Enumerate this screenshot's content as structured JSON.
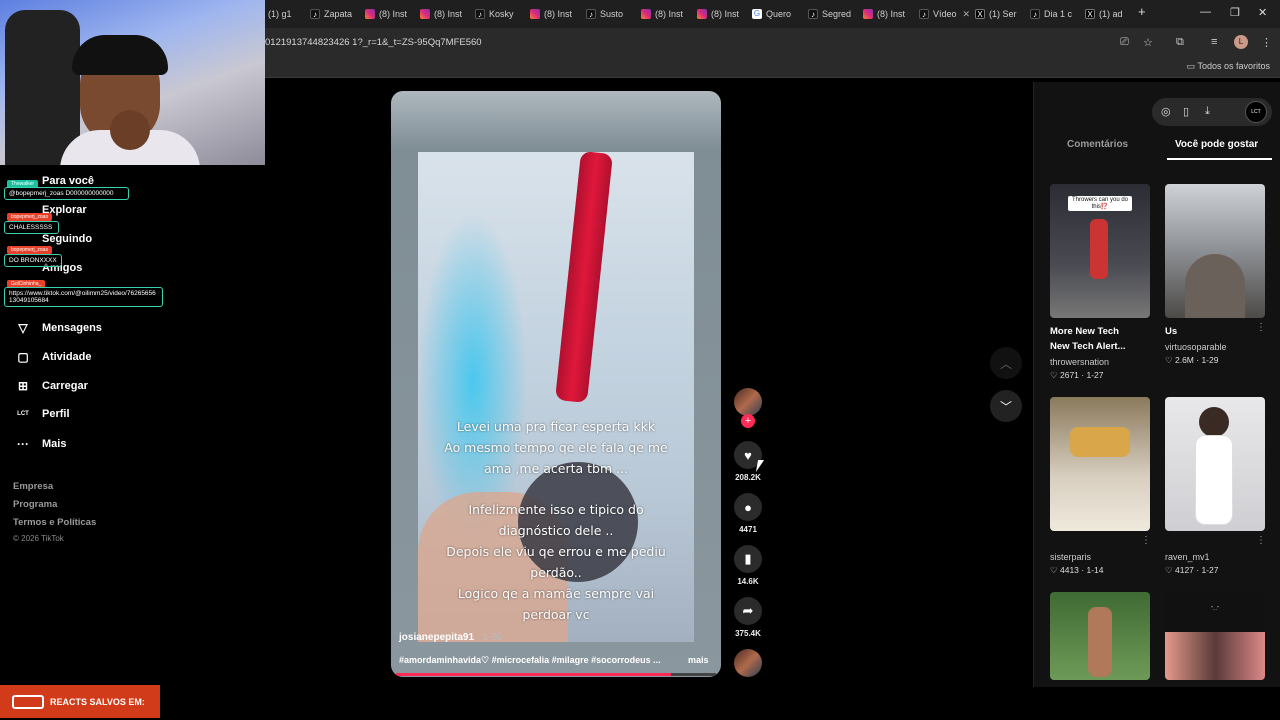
{
  "browser": {
    "tabs": [
      {
        "icon": "g1",
        "label": "(1) g1"
      },
      {
        "icon": "tt",
        "label": "Zapata"
      },
      {
        "icon": "ig",
        "label": "(8) Inst"
      },
      {
        "icon": "ig",
        "label": "(8) Inst"
      },
      {
        "icon": "tt",
        "label": "Kosky"
      },
      {
        "icon": "ig",
        "label": "(8) Inst"
      },
      {
        "icon": "tt",
        "label": "Susto"
      },
      {
        "icon": "ig",
        "label": "(8) Inst"
      },
      {
        "icon": "ig",
        "label": "(8) Inst"
      },
      {
        "icon": "tt",
        "label": "Quero"
      },
      {
        "icon": "tt",
        "label": "Segred"
      },
      {
        "icon": "ig",
        "label": "(8) Inst"
      },
      {
        "icon": "tt",
        "label": "Vídeo"
      },
      {
        "icon": "x",
        "label": "(1) Ser"
      },
      {
        "icon": "tt",
        "label": "Dia 1 c"
      },
      {
        "icon": "x",
        "label": "(1) ad"
      }
    ],
    "new_tab": "+",
    "url": "0121913744823426 1?_r=1&_t=ZS-95Qq7MFE560",
    "profile_initial": "L",
    "bookmarks_all": "Todos os favoritos"
  },
  "sidebar": {
    "items": [
      {
        "icon": "⌂",
        "label": "Para você"
      },
      {
        "icon": "✦",
        "label": "Explorar"
      },
      {
        "icon": "☰",
        "label": "Seguindo"
      },
      {
        "icon": "☺",
        "label": "Amigos"
      },
      {
        "icon": "◈",
        "label": "LIVE"
      },
      {
        "icon": "▽",
        "label": "Mensagens"
      },
      {
        "icon": "▢",
        "label": "Atividade"
      },
      {
        "icon": "⊞",
        "label": "Carregar"
      },
      {
        "icon": "◉",
        "label": "Perfil"
      },
      {
        "icon": "···",
        "label": "Mais"
      }
    ],
    "footer": [
      "Empresa",
      "Programa",
      "Termos e Políticas"
    ],
    "copyright": "© 2026 TikTok"
  },
  "chat_overlay": [
    {
      "tag": "Thewalker",
      "text": "@bopepmerj_zoas D000000000000"
    },
    {
      "tag": "bopepmerj_zoas",
      "text": "CHALESSSSS"
    },
    {
      "tag": "bopepmerj_zoas",
      "text": "DO BRONXXXX"
    },
    {
      "tag": "GolCinhinha_",
      "text": "https://www.tiktok.com/@oilimm25/video/7626565613049105684"
    }
  ],
  "banner": {
    "text": "REACTS SALVOS EM:"
  },
  "video": {
    "caption_lines": [
      "Levei uma pra ficar esperta kkk",
      "Ao mesmo tempo qe ele fala qe me",
      "ama ,me acerta tbm ...",
      "Infelizmente isso e tipico do",
      "diagnóstico dele ..",
      "Depois ele viu qe errou e me pediu",
      "perdão..",
      "Logico qe a mamãe sempre vai",
      "perdoar vc"
    ],
    "author": "josianepepita91",
    "date": " · 1-30",
    "hashtags": "#amordaminhavida♡ #microcefalia #milagre #socorrodeus ...",
    "more": "mais",
    "progress": 0.86
  },
  "actions": {
    "likes": "208.2K",
    "comments": "4471",
    "saves": "14.6K",
    "shares": "375.4K"
  },
  "right_panel": {
    "tabs": [
      "Comentários",
      "Você pode gostar"
    ],
    "suggestions": [
      {
        "thumb_text": "Throwers can you do this⁉️",
        "title": "More New Tech New Tech Alert...",
        "user": "throwersnation",
        "likes": "2671",
        "date": "1-27"
      },
      {
        "thumb_text": "",
        "title": "Us",
        "user": "virtuosoparable",
        "likes": "2.6M",
        "date": "1-29"
      },
      {
        "thumb_text": "",
        "title": "",
        "user": "sisterparis",
        "likes": "4413",
        "date": "1-14"
      },
      {
        "thumb_text": "",
        "title": "",
        "user": "raven_mv1",
        "likes": "4127",
        "date": "1-27"
      },
      {
        "thumb_text": "",
        "title": "",
        "user": "",
        "likes": "",
        "date": ""
      },
      {
        "thumb_text": "\"...\"",
        "title": "",
        "user": "",
        "likes": "",
        "date": ""
      }
    ]
  }
}
